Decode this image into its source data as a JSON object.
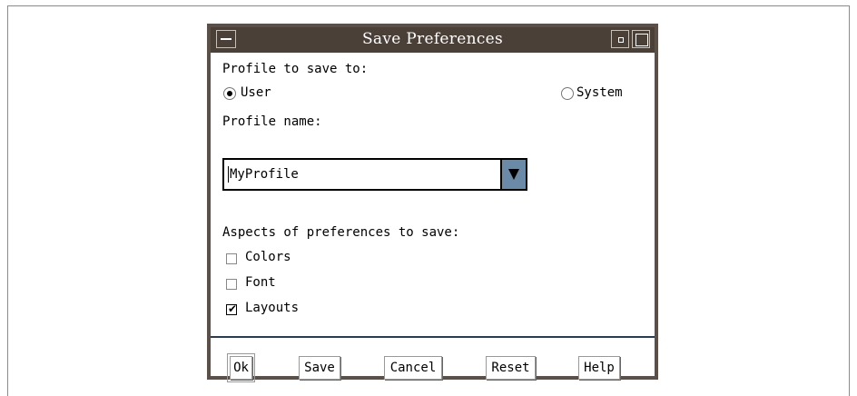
{
  "window": {
    "title": "Save Preferences"
  },
  "profile_section": {
    "heading": "Profile to save to:",
    "options": [
      {
        "label": "User",
        "selected": true
      },
      {
        "label": "System",
        "selected": false
      }
    ]
  },
  "profile_name": {
    "label": "Profile name:",
    "value": "MyProfile"
  },
  "aspects": {
    "heading": "Aspects of preferences to save:",
    "items": [
      {
        "label": "Colors",
        "checked": false
      },
      {
        "label": "Font",
        "checked": false
      },
      {
        "label": "Layouts",
        "checked": true
      }
    ]
  },
  "buttons": {
    "ok": "Ok",
    "save": "Save",
    "cancel": "Cancel",
    "reset": "Reset",
    "help": "Help"
  },
  "colors": {
    "titlebar": "#4a4038",
    "dropdown_arrow": "#6a8aa8",
    "separator": "#283c58"
  },
  "icons": {
    "check": "✔"
  }
}
